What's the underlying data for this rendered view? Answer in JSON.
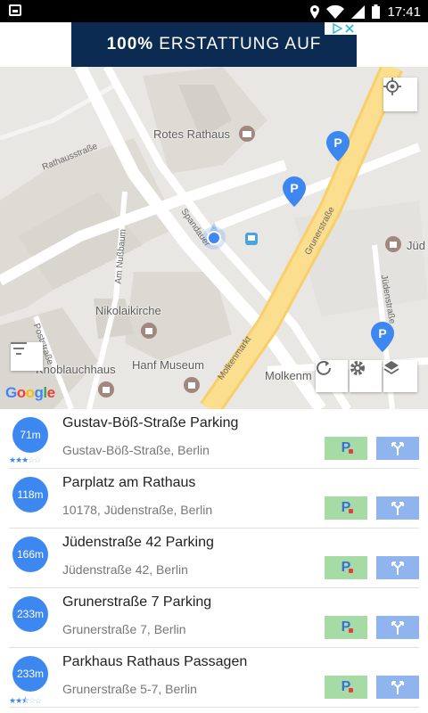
{
  "status_bar": {
    "time": "17:41"
  },
  "ad": {
    "bold": "100%",
    "text": "ERSTATTUNG AUF"
  },
  "map": {
    "labels": {
      "rotes_rathaus": "Rotes Rathaus",
      "nikolaikirche": "Nikolaikirche",
      "hanf_museum": "Hanf Museum",
      "knoblauchhaus": "Knoblauchhaus",
      "molkenmarkt": "Molkenm",
      "juden": "Jüd"
    },
    "streets": {
      "rathausstrasse": "Rathausstraße",
      "spandauer": "Spandauer",
      "grunerstrasse": "Grunerstraße",
      "am_nussbaum": "Am Nußbaum",
      "poststrasse": "Poststraße",
      "molkenmarkt": "Molkenmarkt",
      "judenstrasse": "Jüdenstraße"
    },
    "attribution": "Google"
  },
  "parkings": [
    {
      "distance": "71m",
      "name": "Gustav-Böß-Straße Parking",
      "address": "Gustav-Böß-Straße, Berlin",
      "rating": 3
    },
    {
      "distance": "118m",
      "name": "Parplatz am Rathaus",
      "address": "10178, Jüdenstraße, Berlin",
      "rating": null
    },
    {
      "distance": "166m",
      "name": "Jüdenstraße 42 Parking",
      "address": "Jüdenstraße 42, Berlin",
      "rating": null
    },
    {
      "distance": "233m",
      "name": "Grunerstraße 7 Parking",
      "address": "Grunerstraße 7, Berlin",
      "rating": null
    },
    {
      "distance": "233m",
      "name": "Parkhaus Rathaus Passagen",
      "address": "Grunerstraße 5-7, Berlin",
      "rating": 2.5
    }
  ],
  "colors": {
    "accent": "#3d87f0",
    "ad_bg": "#0b2b52",
    "parking_button": "#a6dba6",
    "navigate_button": "#8fb4ee"
  }
}
